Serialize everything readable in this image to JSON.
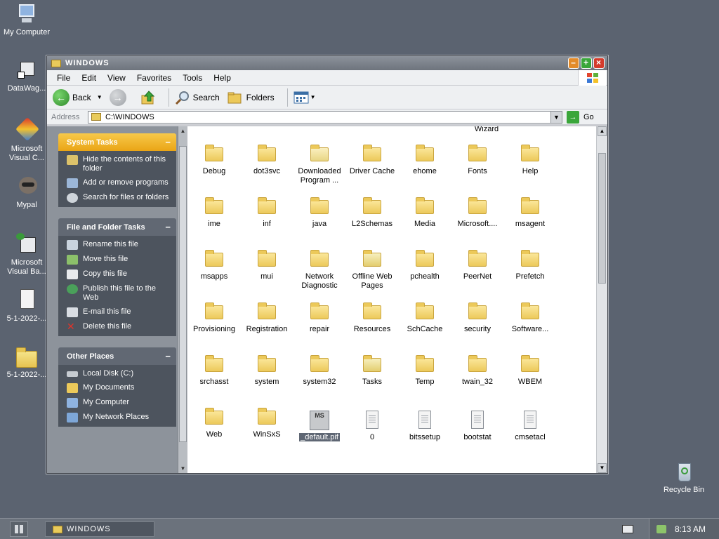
{
  "desktop": {
    "icons": [
      {
        "label": "My Computer",
        "icon": "my-computer-icon"
      },
      {
        "label": "DataWag...",
        "icon": "shortcut-icon"
      },
      {
        "label": "Microsoft Visual C...",
        "icon": "visual-c-icon"
      },
      {
        "label": "Mypal",
        "icon": "mypal-icon"
      },
      {
        "label": "Microsoft Visual Ba...",
        "icon": "visual-basic-icon"
      },
      {
        "label": "5-1-2022-...",
        "icon": "document-icon"
      },
      {
        "label": "5-1-2022-...",
        "icon": "folder-icon"
      },
      {
        "label": "Recycle Bin",
        "icon": "recycle-bin-icon"
      }
    ]
  },
  "window": {
    "title": "WINDOWS",
    "menu": [
      "File",
      "Edit",
      "View",
      "Favorites",
      "Tools",
      "Help"
    ],
    "toolbar": {
      "back": "Back",
      "search": "Search",
      "folders": "Folders"
    },
    "address": {
      "label": "Address",
      "value": "C:\\WINDOWS",
      "go": "Go"
    }
  },
  "tasks": {
    "system": {
      "title": "System Tasks",
      "items": [
        "Hide the contents of this folder",
        "Add or remove programs",
        "Search for files or folders"
      ]
    },
    "file": {
      "title": "File and Folder Tasks",
      "items": [
        "Rename this file",
        "Move this file",
        "Copy this file",
        "Publish this file to the Web",
        "E-mail this file",
        "Delete this file"
      ]
    },
    "other": {
      "title": "Other Places",
      "items": [
        "Local Disk (C:)",
        "My Documents",
        "My Computer",
        "My Network Places"
      ]
    }
  },
  "files": {
    "partial_top": "Wizard",
    "items": [
      {
        "label": "Debug",
        "type": "folder"
      },
      {
        "label": "dot3svc",
        "type": "folder"
      },
      {
        "label": "Downloaded Program ...",
        "type": "folder-open"
      },
      {
        "label": "Driver Cache",
        "type": "folder"
      },
      {
        "label": "ehome",
        "type": "folder"
      },
      {
        "label": "Fonts",
        "type": "folder"
      },
      {
        "label": "Help",
        "type": "folder"
      },
      {
        "label": "ime",
        "type": "folder"
      },
      {
        "label": "inf",
        "type": "folder"
      },
      {
        "label": "java",
        "type": "folder"
      },
      {
        "label": "L2Schemas",
        "type": "folder"
      },
      {
        "label": "Media",
        "type": "folder"
      },
      {
        "label": "Microsoft....",
        "type": "folder"
      },
      {
        "label": "msagent",
        "type": "folder"
      },
      {
        "label": "msapps",
        "type": "folder"
      },
      {
        "label": "mui",
        "type": "folder"
      },
      {
        "label": "Network Diagnostic",
        "type": "folder"
      },
      {
        "label": "Offline Web Pages",
        "type": "folder-special"
      },
      {
        "label": "pchealth",
        "type": "folder"
      },
      {
        "label": "PeerNet",
        "type": "folder"
      },
      {
        "label": "Prefetch",
        "type": "folder"
      },
      {
        "label": "Provisioning",
        "type": "folder"
      },
      {
        "label": "Registration",
        "type": "folder"
      },
      {
        "label": "repair",
        "type": "folder"
      },
      {
        "label": "Resources",
        "type": "folder"
      },
      {
        "label": "SchCache",
        "type": "folder"
      },
      {
        "label": "security",
        "type": "folder"
      },
      {
        "label": "Software...",
        "type": "folder"
      },
      {
        "label": "srchasst",
        "type": "folder"
      },
      {
        "label": "system",
        "type": "folder"
      },
      {
        "label": "system32",
        "type": "folder"
      },
      {
        "label": "Tasks",
        "type": "folder-special"
      },
      {
        "label": "Temp",
        "type": "folder"
      },
      {
        "label": "twain_32",
        "type": "folder"
      },
      {
        "label": "WBEM",
        "type": "folder"
      },
      {
        "label": "Web",
        "type": "folder"
      },
      {
        "label": "WinSxS",
        "type": "folder"
      },
      {
        "label": "_default.pif",
        "type": "pif",
        "selected": true
      },
      {
        "label": "0",
        "type": "file"
      },
      {
        "label": "bitssetup",
        "type": "file"
      },
      {
        "label": "bootstat",
        "type": "file"
      },
      {
        "label": "cmsetacl",
        "type": "file"
      }
    ]
  },
  "taskbar": {
    "item": "WINDOWS",
    "time": "8:13 AM"
  }
}
